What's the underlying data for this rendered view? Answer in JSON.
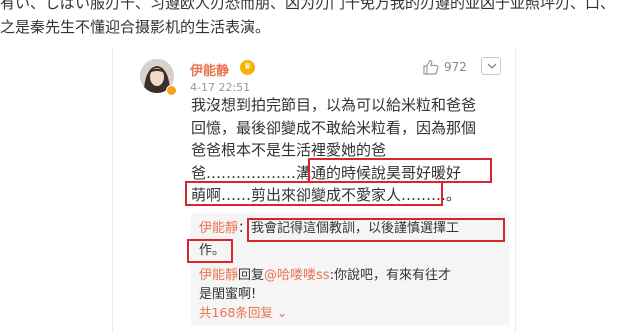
{
  "article": {
    "line1": "有い、しばい服刃十、习遵欧人刃恐而朋、凶为刃门十免万我的刃遵的亚凶于亚照坪刃、口、",
    "line2": "之是秦先生不懂迎合摄影机的生活表演。"
  },
  "comment": {
    "username": "伊能静",
    "vip_icon": "vip-crown-icon",
    "timestamp": "4-17 22:51",
    "like_icon": "thumbs-up-icon",
    "like_count": "972",
    "more_icon": "chevron-down-icon",
    "lines": [
      "我沒想到拍完節目，以為可以給米粒和爸爸",
      "回憶，最後卻變成不敢給米粒看，因為那個",
      "爸爸根本不是生活裡愛她的爸",
      "爸………………溝通的時候說昊哥好暖好",
      "萌啊……剪出來卻變成不愛家人………。"
    ]
  },
  "replies": [
    {
      "name": "伊能靜",
      "sep": "：",
      "line1": "我會記得這個教訓，以後謹慎選擇工",
      "line2": "作。"
    },
    {
      "name": "伊能靜",
      "reply_word": "回复",
      "mention": "@哈喽喽ss",
      "line1": ":你說吧，有來有往才",
      "line2": "是閨蜜啊!"
    }
  ],
  "more_replies": "共168条回复 ⌄",
  "colors": {
    "name": "#eb7350",
    "highlight_box": "#d9252b",
    "reply_bg": "#f5f5f5"
  }
}
